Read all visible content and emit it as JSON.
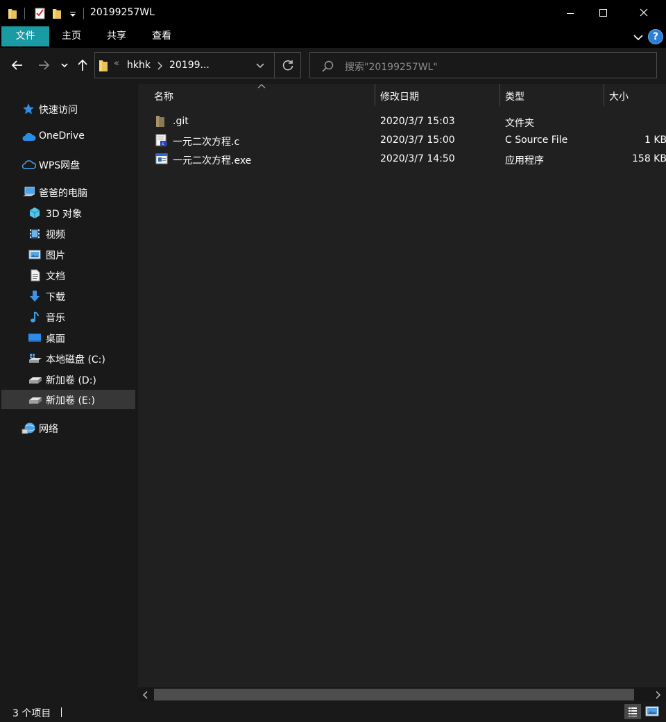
{
  "window": {
    "title": "20199257WL"
  },
  "ribbon": {
    "tabs": [
      "文件",
      "主页",
      "共享",
      "查看"
    ],
    "help_label": "?"
  },
  "address": {
    "overflow": "«",
    "segments": [
      "hkhk",
      "20199..."
    ],
    "search_placeholder": "搜索\"20199257WL\""
  },
  "sidebar": {
    "items": [
      {
        "label": "快速访问",
        "icon": "star-icon"
      },
      {
        "label": "OneDrive",
        "icon": "cloud-icon"
      },
      {
        "label": "WPS网盘",
        "icon": "cloud-outline-icon"
      },
      {
        "label": "爸爸的电脑",
        "icon": "computer-icon"
      },
      {
        "label": "3D 对象",
        "icon": "cube-icon"
      },
      {
        "label": "视频",
        "icon": "video-icon"
      },
      {
        "label": "图片",
        "icon": "picture-icon"
      },
      {
        "label": "文档",
        "icon": "document-icon"
      },
      {
        "label": "下载",
        "icon": "download-icon"
      },
      {
        "label": "音乐",
        "icon": "music-icon"
      },
      {
        "label": "桌面",
        "icon": "desktop-icon"
      },
      {
        "label": "本地磁盘 (C:)",
        "icon": "system-drive-icon"
      },
      {
        "label": "新加卷 (D:)",
        "icon": "drive-icon"
      },
      {
        "label": "新加卷 (E:)",
        "icon": "drive-icon"
      },
      {
        "label": "网络",
        "icon": "network-icon"
      }
    ],
    "selected": "新加卷 (E:)"
  },
  "columns": [
    "名称",
    "修改日期",
    "类型",
    "大小"
  ],
  "files": [
    {
      "name": ".git",
      "modified": "2020/3/7 15:03",
      "type": "文件夹",
      "size": "",
      "icon": "folder-icon"
    },
    {
      "name": "一元二次方程.c",
      "modified": "2020/3/7 15:00",
      "type": "C Source File",
      "size": "1 KB",
      "icon": "c-source-file-icon"
    },
    {
      "name": "一元二次方程.exe",
      "modified": "2020/3/7 14:50",
      "type": "应用程序",
      "size": "158 KB",
      "icon": "exe-file-icon"
    }
  ],
  "status": {
    "count": "3 个项目"
  },
  "colors": {
    "accent": "#1a9aa3",
    "background": "#191919",
    "pane": "#202020",
    "selection": "#373737"
  }
}
